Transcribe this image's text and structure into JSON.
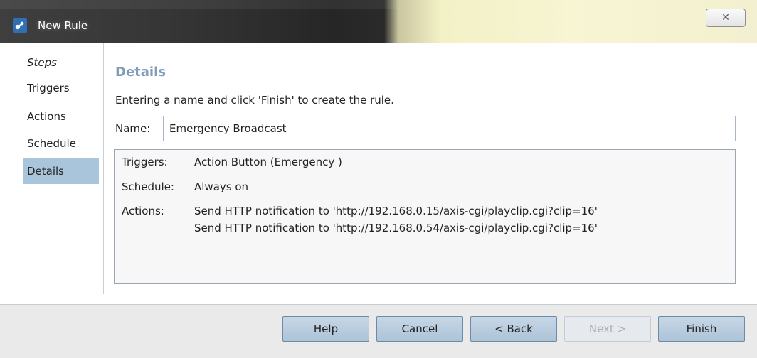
{
  "window": {
    "title": "New Rule",
    "close_glyph": "✕"
  },
  "steps": {
    "heading": "Steps",
    "items": [
      {
        "label": "Triggers",
        "active": false
      },
      {
        "label": "Actions",
        "active": false
      },
      {
        "label": "Schedule",
        "active": false
      },
      {
        "label": "Details",
        "active": true
      }
    ]
  },
  "details": {
    "title": "Details",
    "instruction": "Entering a name and click 'Finish' to create the rule.",
    "name_label": "Name:",
    "name_value": "Emergency Broadcast"
  },
  "summary": {
    "triggers_label": "Triggers:",
    "triggers_value": "Action Button (Emergency )",
    "schedule_label": "Schedule:",
    "schedule_value": "Always on",
    "actions_label": "Actions:",
    "actions": [
      "Send HTTP notification to 'http://192.168.0.15/axis-cgi/playclip.cgi?clip=16'",
      "Send HTTP notification to 'http://192.168.0.54/axis-cgi/playclip.cgi?clip=16'"
    ]
  },
  "buttons": {
    "help": "Help",
    "cancel": "Cancel",
    "back": "< Back",
    "next": "Next >",
    "finish": "Finish"
  },
  "colors": {
    "selected_step": "#a9c5dc",
    "details_title": "#7f9db8",
    "button_face": "#b9cde0"
  }
}
